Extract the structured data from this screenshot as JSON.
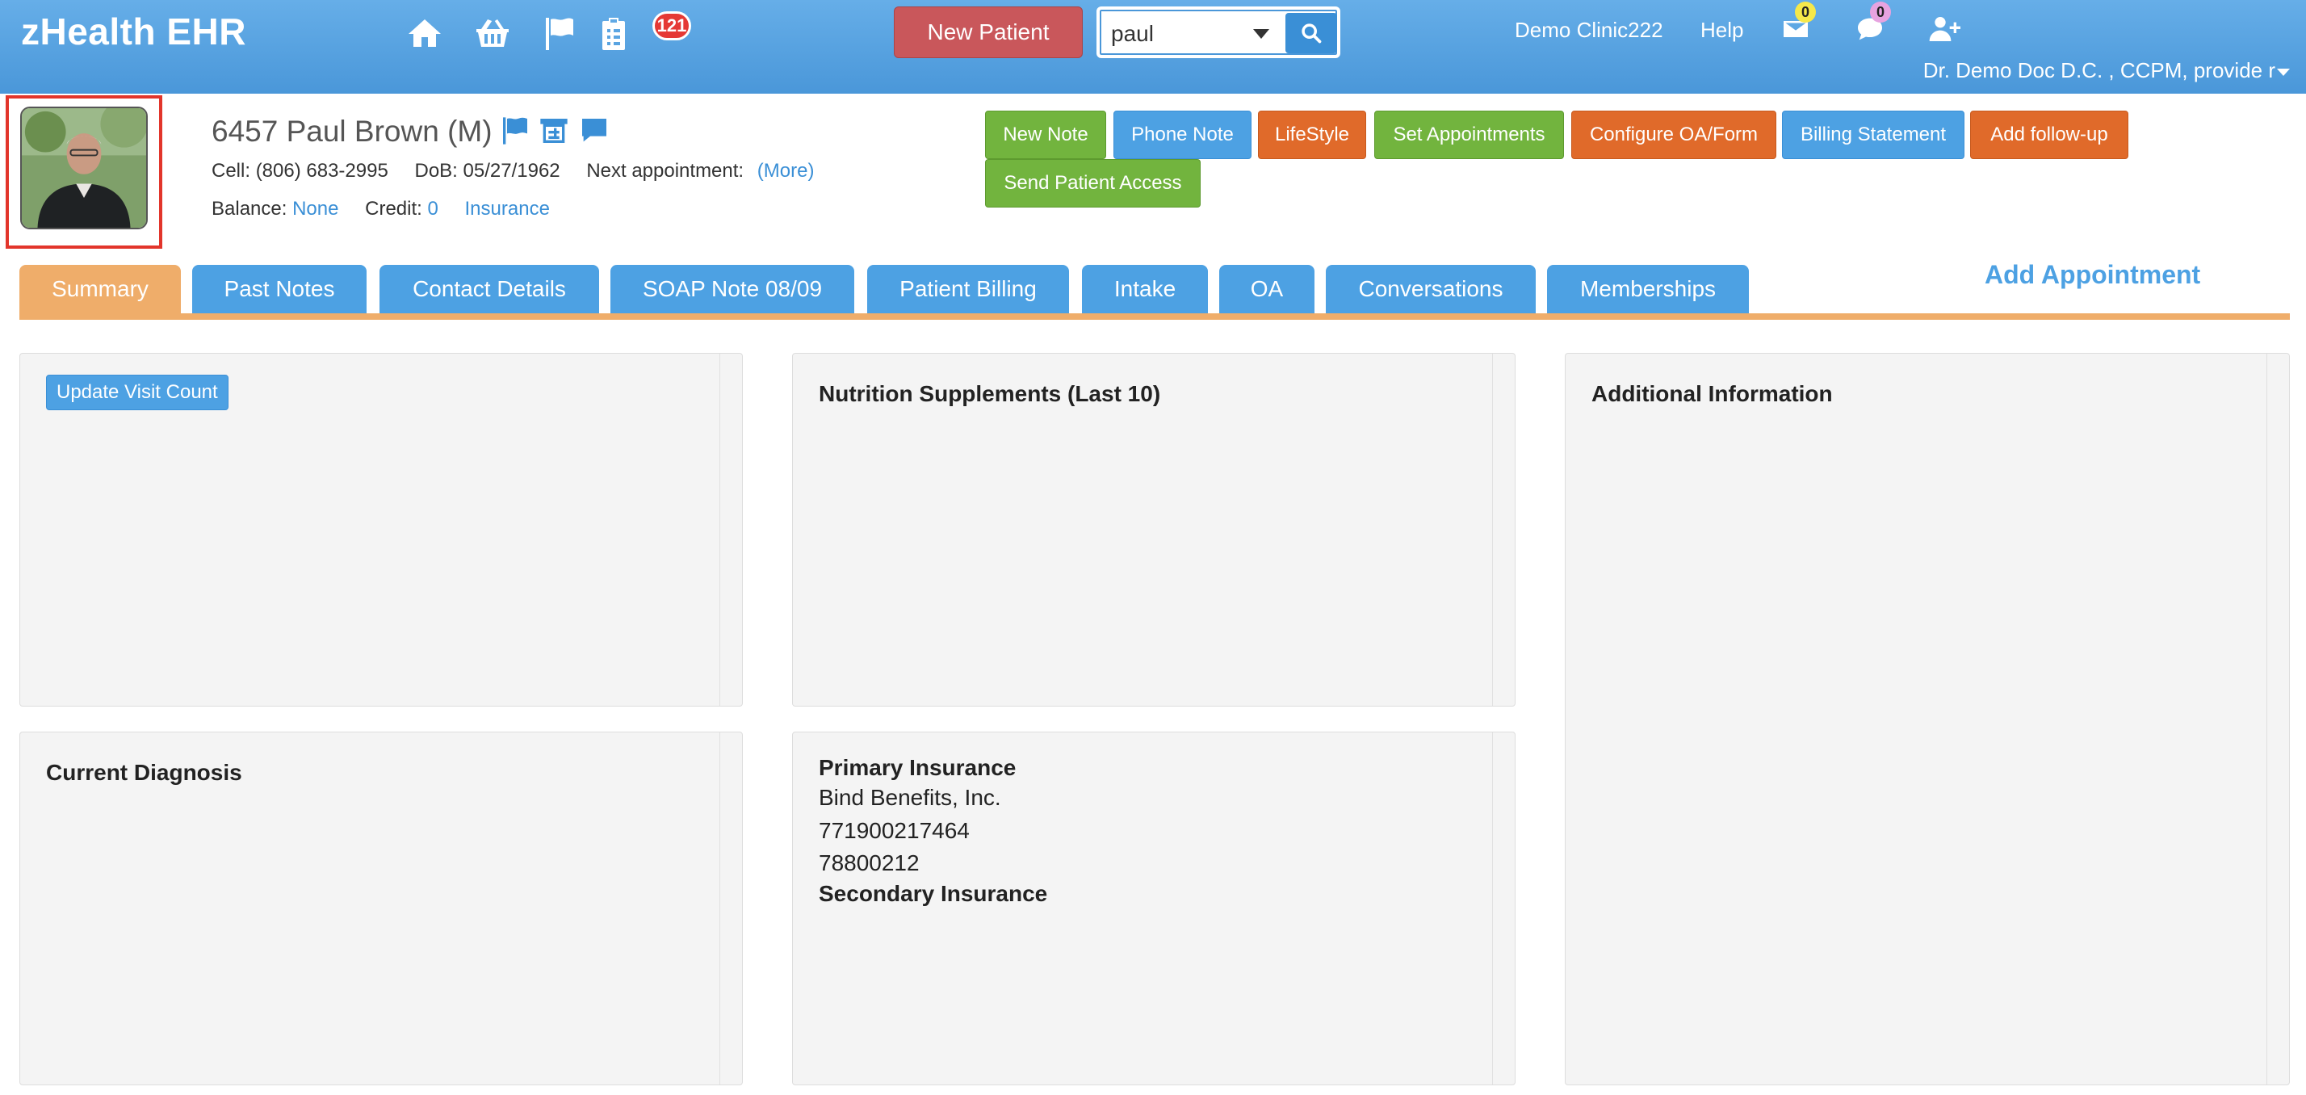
{
  "app": {
    "title": "zHealth EHR"
  },
  "nav": {
    "icons": [
      "home-icon",
      "basket-icon",
      "flag-icon",
      "clipboard-icon"
    ],
    "task_badge": "121",
    "new_patient_label": "New Patient",
    "search": {
      "value": "paul"
    },
    "clinic": "Demo Clinic222",
    "help": "Help",
    "mail_badge": "0",
    "chat_badge": "0",
    "user": "Dr. Demo Doc D.C. , CCPM, provide r"
  },
  "patient": {
    "name": "6457 Paul Brown (M)",
    "cell_label": "Cell:",
    "cell": "(806) 683-2995",
    "dob_label": "DoB:",
    "dob": "05/27/1962",
    "next_appt_label": "Next appointment:",
    "more_link": "(More)",
    "balance_label": "Balance:",
    "balance": "None",
    "credit_label": "Credit:",
    "credit": "0",
    "insurance_link": "Insurance"
  },
  "actions": {
    "new_note": "New Note",
    "phone_note": "Phone Note",
    "lifestyle": "LifeStyle",
    "set_appointments": "Set Appointments",
    "configure_oa": "Configure OA/Form",
    "billing_statement": "Billing Statement",
    "add_followup": "Add follow-up",
    "send_access": "Send Patient Access"
  },
  "tabs": [
    "Summary",
    "Past Notes",
    "Contact Details",
    "SOAP Note 08/09",
    "Patient Billing",
    "Intake",
    "OA",
    "Conversations",
    "Memberships"
  ],
  "add_appointment": "Add Appointment",
  "panels": {
    "update_visit_count": "Update Visit Count",
    "nutrition_title": "Nutrition Supplements (Last 10)",
    "additional_title": "Additional Information",
    "diagnosis_title": "Current Diagnosis",
    "primary_ins_title": "Primary Insurance",
    "primary_ins_lines": [
      "Bind Benefits, Inc.",
      "771900217464",
      "78800212"
    ],
    "secondary_ins_title": "Secondary Insurance"
  },
  "colors": {
    "navbar": "#4a97d9",
    "accent_blue": "#4da1e3",
    "tab_active": "#efad6a",
    "green_button": "#72b43e",
    "orange_button": "#e06a2a",
    "new_patient_button": "#c9575b",
    "photo_highlight": "#e2352b"
  }
}
